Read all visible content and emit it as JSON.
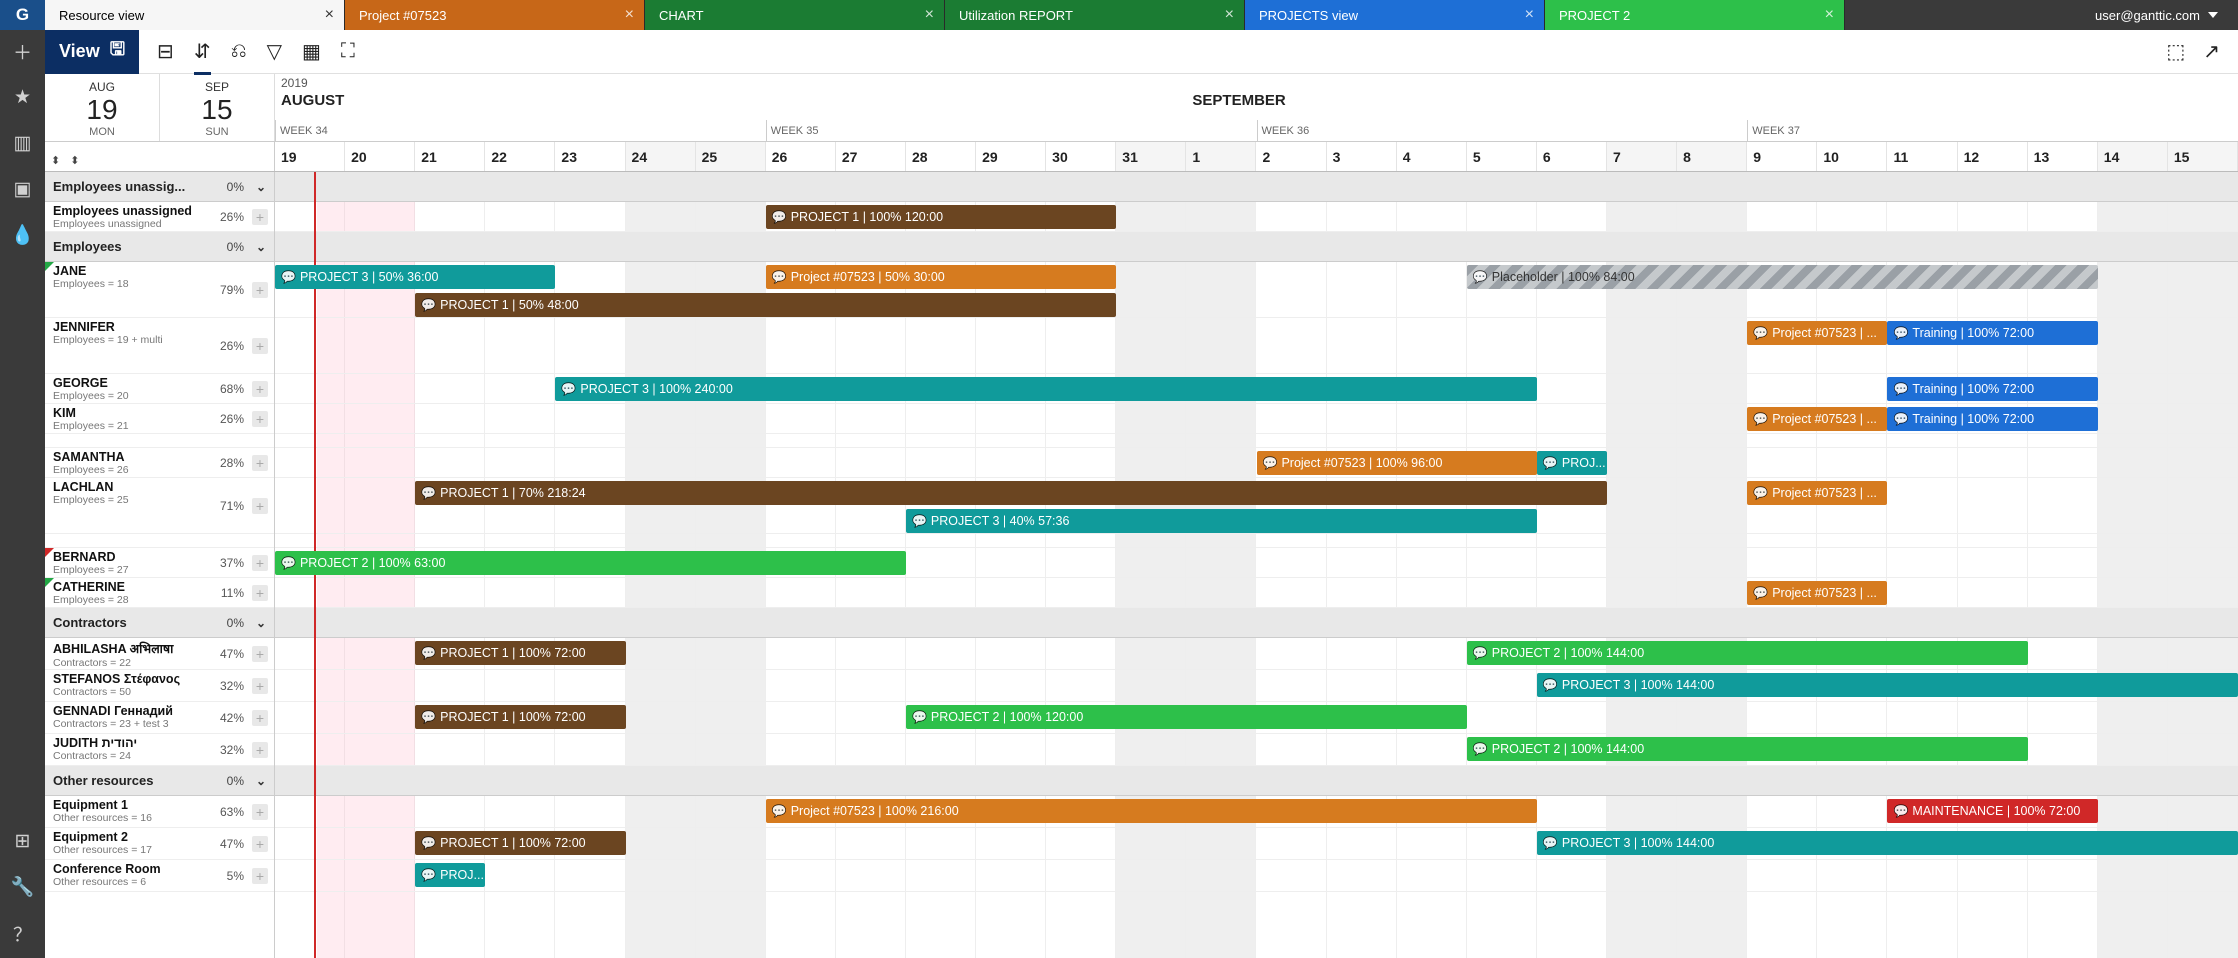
{
  "user_email": "user@ganttic.com",
  "logo_letter": "G",
  "tabs": [
    {
      "label": "Resource view",
      "close": "×"
    },
    {
      "label": "Project #07523",
      "close": "×"
    },
    {
      "label": "CHART",
      "close": "×"
    },
    {
      "label": "Utilization REPORT",
      "close": "×"
    },
    {
      "label": "PROJECTS view",
      "close": "×"
    },
    {
      "label": "PROJECT 2",
      "close": "×"
    }
  ],
  "view_btn": "View",
  "date_from": {
    "month": "AUG",
    "day": "19",
    "weekday": "MON"
  },
  "date_to": {
    "month": "SEP",
    "day": "15",
    "weekday": "SUN"
  },
  "year": "2019",
  "months": [
    "AUGUST",
    "SEPTEMBER"
  ],
  "weeks": [
    "WEEK 34",
    "WEEK 35",
    "WEEK 36",
    "WEEK 37"
  ],
  "days": [
    "19",
    "20",
    "21",
    "22",
    "23",
    "24",
    "25",
    "26",
    "27",
    "28",
    "29",
    "30",
    "31",
    "1",
    "2",
    "3",
    "4",
    "5",
    "6",
    "7",
    "8",
    "9",
    "10",
    "11",
    "12",
    "13",
    "14",
    "15"
  ],
  "groups": [
    {
      "label": "Employees unassig...",
      "pct": "0%"
    },
    {
      "label": "Employees",
      "pct": "0%"
    },
    {
      "label": "Contractors",
      "pct": "0%"
    },
    {
      "label": "Other resources",
      "pct": "0%"
    }
  ],
  "resources": {
    "unassigned": [
      {
        "name": "Employees unassigned",
        "sub": "Employees unassigned",
        "pct": "26%"
      }
    ],
    "employees": [
      {
        "name": "JANE",
        "sub": "Employees = 18",
        "pct": "79%",
        "flag": "g"
      },
      {
        "name": "JENNIFER",
        "sub": "Employees = 19 + multi",
        "pct": "26%"
      },
      {
        "name": "GEORGE",
        "sub": "Employees = 20",
        "pct": "68%"
      },
      {
        "name": "KIM",
        "sub": "Employees = 21",
        "pct": "26%"
      },
      {
        "name": "SAMANTHA",
        "sub": "Employees = 26",
        "pct": "28%"
      },
      {
        "name": "LACHLAN",
        "sub": "Employees = 25",
        "pct": "71%"
      },
      {
        "name": "BERNARD",
        "sub": "Employees = 27",
        "pct": "37%",
        "flag": "r"
      },
      {
        "name": "CATHERINE",
        "sub": "Employees = 28",
        "pct": "11%",
        "flag": "g"
      }
    ],
    "contractors": [
      {
        "name": "ABHILASHA अभिलाषा",
        "sub": "Contractors = 22",
        "pct": "47%"
      },
      {
        "name": "STEFANOS Στέφανος",
        "sub": "Contractors = 50",
        "pct": "32%"
      },
      {
        "name": "GENNADI Геннадий",
        "sub": "Contractors = 23 + test 3",
        "pct": "42%"
      },
      {
        "name": "JUDITH יהודית",
        "sub": "Contractors = 24",
        "pct": "32%"
      }
    ],
    "other": [
      {
        "name": "Equipment 1",
        "sub": "Other resources = 16",
        "pct": "63%"
      },
      {
        "name": "Equipment 2",
        "sub": "Other resources = 17",
        "pct": "47%"
      },
      {
        "name": "Conference Room",
        "sub": "Other resources = 6",
        "pct": "5%"
      }
    ]
  },
  "tasks": {
    "unassigned0": [
      {
        "label": "PROJECT 1 | 100% 120:00",
        "cls": "brown",
        "start": 7,
        "end": 12
      }
    ],
    "jane": [
      {
        "label": "PROJECT 3 | 50% 36:00",
        "cls": "teal",
        "start": 0,
        "end": 4,
        "row": 0
      },
      {
        "label": "Project #07523 | 50% 30:00",
        "cls": "orange",
        "start": 7,
        "end": 12,
        "row": 0
      },
      {
        "label": "Placeholder | 100% 84:00",
        "cls": "hatched",
        "start": 17,
        "end": 26,
        "row": 0
      },
      {
        "label": "PROJECT 1 | 50% 48:00",
        "cls": "brown",
        "start": 2,
        "end": 12,
        "row": 1
      }
    ],
    "jennifer": [
      {
        "label": "Project #07523 | ...",
        "cls": "orange",
        "start": 21,
        "end": 23,
        "row": 0
      },
      {
        "label": "Training | 100% 72:00",
        "cls": "blue",
        "start": 23,
        "end": 26,
        "row": 0
      }
    ],
    "george": [
      {
        "label": "PROJECT 3 | 100% 240:00",
        "cls": "teal",
        "start": 4,
        "end": 18,
        "row": 0
      },
      {
        "label": "Training | 100% 72:00",
        "cls": "blue",
        "start": 23,
        "end": 26,
        "row": 0
      }
    ],
    "kim": [
      {
        "label": "Project #07523 | ...",
        "cls": "orange",
        "start": 21,
        "end": 23,
        "row": 0
      },
      {
        "label": "Training | 100% 72:00",
        "cls": "blue",
        "start": 23,
        "end": 26,
        "row": 0
      }
    ],
    "samantha": [
      {
        "label": "Project #07523 | 100% 96:00",
        "cls": "orange",
        "start": 14,
        "end": 18,
        "row": 0
      },
      {
        "label": "PROJ...",
        "cls": "teal",
        "start": 18,
        "end": 19,
        "row": 0
      }
    ],
    "lachlan": [
      {
        "label": "PROJECT 1 | 70% 218:24",
        "cls": "brown",
        "start": 2,
        "end": 19,
        "row": 0
      },
      {
        "label": "Project #07523 | ...",
        "cls": "orange",
        "start": 21,
        "end": 23,
        "row": 0
      },
      {
        "label": "PROJECT 3 | 40% 57:36",
        "cls": "teal",
        "start": 9,
        "end": 18,
        "row": 1
      }
    ],
    "bernard": [
      {
        "label": "PROJECT 2 | 100% 63:00",
        "cls": "green",
        "start": 0,
        "end": 9,
        "row": 0
      }
    ],
    "catherine": [
      {
        "label": "Project #07523 | ...",
        "cls": "orange",
        "start": 21,
        "end": 23,
        "row": 0
      }
    ],
    "abhilasha": [
      {
        "label": "PROJECT 1 | 100% 72:00",
        "cls": "brown",
        "start": 2,
        "end": 5,
        "row": 0
      },
      {
        "label": "PROJECT 2 | 100% 144:00",
        "cls": "green",
        "start": 17,
        "end": 25,
        "row": 0
      }
    ],
    "stefanos": [
      {
        "label": "PROJECT 3 | 100% 144:00",
        "cls": "teal",
        "start": 18,
        "end": 28,
        "row": 0
      }
    ],
    "gennadi": [
      {
        "label": "PROJECT 1 | 100% 72:00",
        "cls": "brown",
        "start": 2,
        "end": 5,
        "row": 0
      },
      {
        "label": "PROJECT 2 | 100% 120:00",
        "cls": "green",
        "start": 9,
        "end": 17,
        "row": 0
      }
    ],
    "judith": [
      {
        "label": "PROJECT 2 | 100% 144:00",
        "cls": "green",
        "start": 17,
        "end": 25,
        "row": 0
      }
    ],
    "equip1": [
      {
        "label": "Project #07523 | 100% 216:00",
        "cls": "orange",
        "start": 7,
        "end": 18,
        "row": 0
      },
      {
        "label": "MAINTENANCE | 100% 72:00",
        "cls": "red",
        "start": 23,
        "end": 26,
        "row": 0
      }
    ],
    "equip2": [
      {
        "label": "PROJECT 1 | 100% 72:00",
        "cls": "brown",
        "start": 2,
        "end": 5,
        "row": 0
      },
      {
        "label": "PROJECT 3 | 100% 144:00",
        "cls": "teal",
        "start": 18,
        "end": 28,
        "row": 0
      }
    ],
    "conf": [
      {
        "label": "PROJ...",
        "cls": "teal",
        "start": 2,
        "end": 3,
        "row": 0
      }
    ]
  },
  "icons": {
    "plus": "＋",
    "star": "★",
    "chart": "▥",
    "clipboard": "▣",
    "drop": "💧",
    "gear": "⚙",
    "wrench": "🔧",
    "help": "？",
    "save": "🖫",
    "indent": "☰",
    "sort": "⇅",
    "filter1": "⎅",
    "filter2": "▽",
    "box": "▦",
    "fullscreen": "⛶",
    "import": "⬇",
    "share": "↗",
    "bubble": "💬"
  }
}
